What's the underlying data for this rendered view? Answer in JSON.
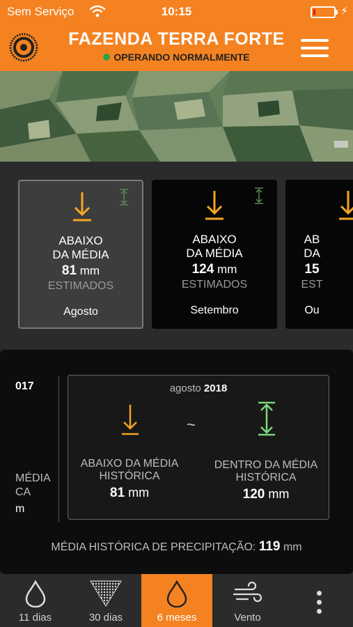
{
  "status_bar": {
    "carrier": "Sem Serviço",
    "time": "10:15",
    "battery_level": 0.12,
    "battery_color": "#e31b23"
  },
  "header": {
    "title": "FAZENDA TERRA FORTE",
    "status": "OPERANDO NORMALMENTE",
    "status_color": "#2ea043",
    "background": "#f58220",
    "logo_icon": "target-logo-icon",
    "menu_icon": "hamburger-menu-icon"
  },
  "map": {
    "icon": "satellite-map"
  },
  "cards": [
    {
      "line1": "ABAIXO",
      "line2": "DA MÉDIA",
      "value": "81",
      "unit": "mm",
      "estimate": "ESTIMADOS",
      "month": "Agosto",
      "icon": "arrow-down-icon",
      "selected": true
    },
    {
      "line1": "ABAIXO",
      "line2": "DA MÉDIA",
      "value": "124",
      "unit": "mm",
      "estimate": "ESTIMADOS",
      "month": "Setembro",
      "icon": "arrow-down-icon",
      "selected": false
    },
    {
      "line1": "AB",
      "line2": "DA",
      "value": "15",
      "unit": "",
      "estimate": "EST",
      "month": "Ou",
      "icon": "arrow-down-icon",
      "selected": false
    }
  ],
  "detail": {
    "previous": {
      "year": "017",
      "line1": "MÉDIA",
      "line2": "CA",
      "unit": "m"
    },
    "month": "agosto",
    "year": "2018",
    "separator": "~",
    "left": {
      "line1": "ABAIXO DA MÉDIA",
      "line2": "HISTÓRICA",
      "value": "81",
      "unit": "mm",
      "icon": "arrow-down-icon",
      "color": "#f5a623"
    },
    "right": {
      "line1": "DENTRO DA MÉDIA",
      "line2": "HISTÓRICA",
      "value": "120",
      "unit": "mm",
      "icon": "range-arrows-icon",
      "color": "#7ed67e"
    },
    "historical_label": "MÉDIA HISTÓRICA DE PRECIPITAÇÃO:",
    "historical_value": "119",
    "historical_unit": "mm"
  },
  "tabs": [
    {
      "label": "11 dias",
      "icon": "drop-icon",
      "active": false
    },
    {
      "label": "30 dias",
      "icon": "rain-triangle-icon",
      "active": false
    },
    {
      "label": "6 meses",
      "icon": "drop-icon",
      "active": true
    },
    {
      "label": "Vento",
      "icon": "wind-icon",
      "active": false
    }
  ],
  "more_icon": "more-vertical-icon"
}
